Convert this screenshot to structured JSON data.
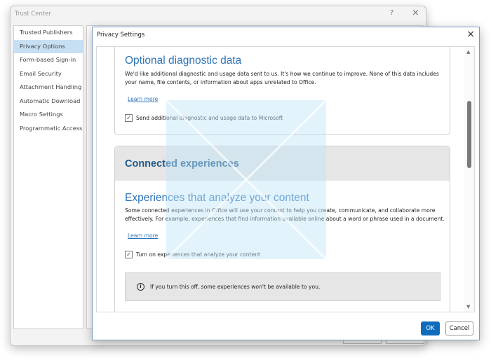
{
  "trust_center": {
    "title": "Trust Center",
    "help": "?",
    "close": "×",
    "sidebar": [
      "Trusted Publishers",
      "Privacy Options",
      "Form-based Sign-in",
      "Email Security",
      "Attachment Handling",
      "Automatic Download",
      "Macro Settings",
      "Programmatic Access"
    ],
    "selected_index": 1
  },
  "privacy": {
    "title": "Privacy Settings",
    "close": "×",
    "diagnostic": {
      "heading": "Optional diagnostic data",
      "text": "We'd like additional diagnostic and usage data sent to us. It's how we continue to improve. None of this data includes your name, file contents, or information about apps unrelated to Office.",
      "learn_more": "Learn more",
      "checkbox_label": "Send additional diagnostic and usage data to Microsoft",
      "checked": true
    },
    "connected": {
      "heading": "Connected experiences",
      "sub_heading": "Experiences that analyze your content",
      "text": "Some connected experiences in Office will use your content to help you create, communicate, and collaborate more effectively. For example, experiences that find information available online about a word or phrase used in a document.",
      "learn_more": "Learn more",
      "checkbox_label": "Turn on experiences that analyze your content",
      "checked": true,
      "info": "If you turn this off, some experiences won't be available to you."
    },
    "ok": "OK",
    "cancel": "Cancel"
  },
  "icons": {
    "check": "✓",
    "info": "i",
    "up": "▲",
    "down": "▼"
  }
}
